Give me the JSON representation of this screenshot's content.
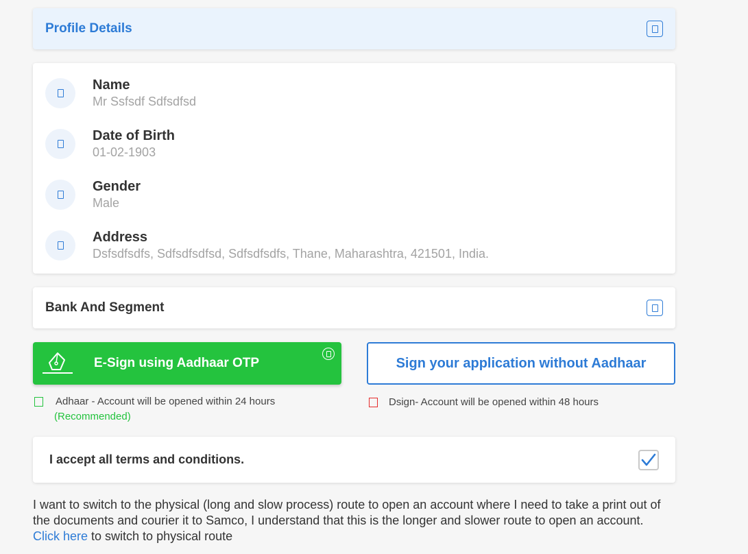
{
  "profile": {
    "title": "Profile Details",
    "fields": [
      {
        "label": "Name",
        "value": "Mr Ssfsdf Sdfsdfsd"
      },
      {
        "label": "Date of Birth",
        "value": "01-02-1903"
      },
      {
        "label": "Gender",
        "value": "Male"
      },
      {
        "label": "Address",
        "value": "Dsfsdfsdfs, Sdfsdfsdfsd, Sdfsdfsdfs, Thane, Maharashtra, 421501, India."
      }
    ]
  },
  "bank": {
    "title": "Bank And Segment"
  },
  "esign": {
    "aadhaar_button": "E-Sign using Aadhaar OTP",
    "without_aadhaar_button": "Sign your application without Aadhaar",
    "aadhaar_note": "Adhaar - Account will be opened within 24 hours",
    "recommended": "(Recommended)",
    "dsign_note": "Dsign- Account will be opened within 48 hours",
    "accent_green": "#24c33e",
    "accent_blue": "#2d7bd6",
    "accent_red": "#e52b2b"
  },
  "terms": {
    "label": "I accept all terms and conditions.",
    "checked": true
  },
  "physical": {
    "text": "I want to switch to the physical (long and slow process) route to open an account where I need to take a print out of the documents and courier it to Samco, I understand that this is the longer and slower route to open an account.",
    "link": "Click here",
    "suffix": " to switch to physical route"
  }
}
